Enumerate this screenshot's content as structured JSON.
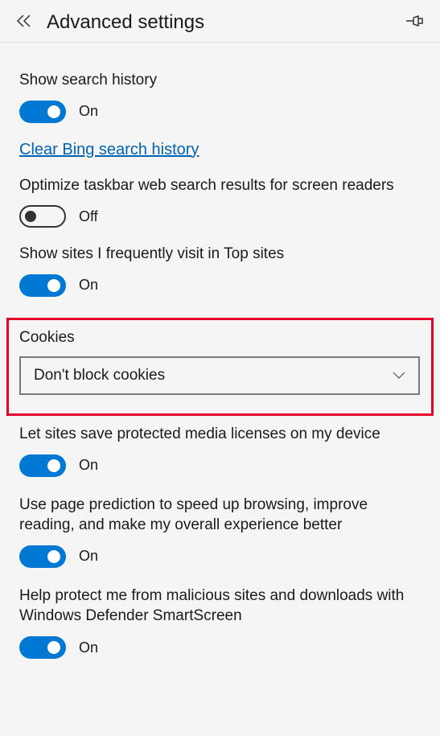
{
  "header": {
    "title": "Advanced settings"
  },
  "settings": {
    "searchHistory": {
      "label": "Show search history",
      "state": "On"
    },
    "clearBingLink": "Clear Bing search history",
    "optimizeTaskbar": {
      "label": "Optimize taskbar web search results for screen readers",
      "state": "Off"
    },
    "topSites": {
      "label": "Show sites I frequently visit in Top sites",
      "state": "On"
    },
    "cookies": {
      "label": "Cookies",
      "selected": "Don't block cookies"
    },
    "mediaLicenses": {
      "label": "Let sites save protected media licenses on my device",
      "state": "On"
    },
    "pagePrediction": {
      "label": "Use page prediction to speed up browsing, improve reading, and make my overall experience better",
      "state": "On"
    },
    "smartScreen": {
      "label": "Help protect me from malicious sites and downloads with Windows Defender SmartScreen",
      "state": "On"
    }
  }
}
